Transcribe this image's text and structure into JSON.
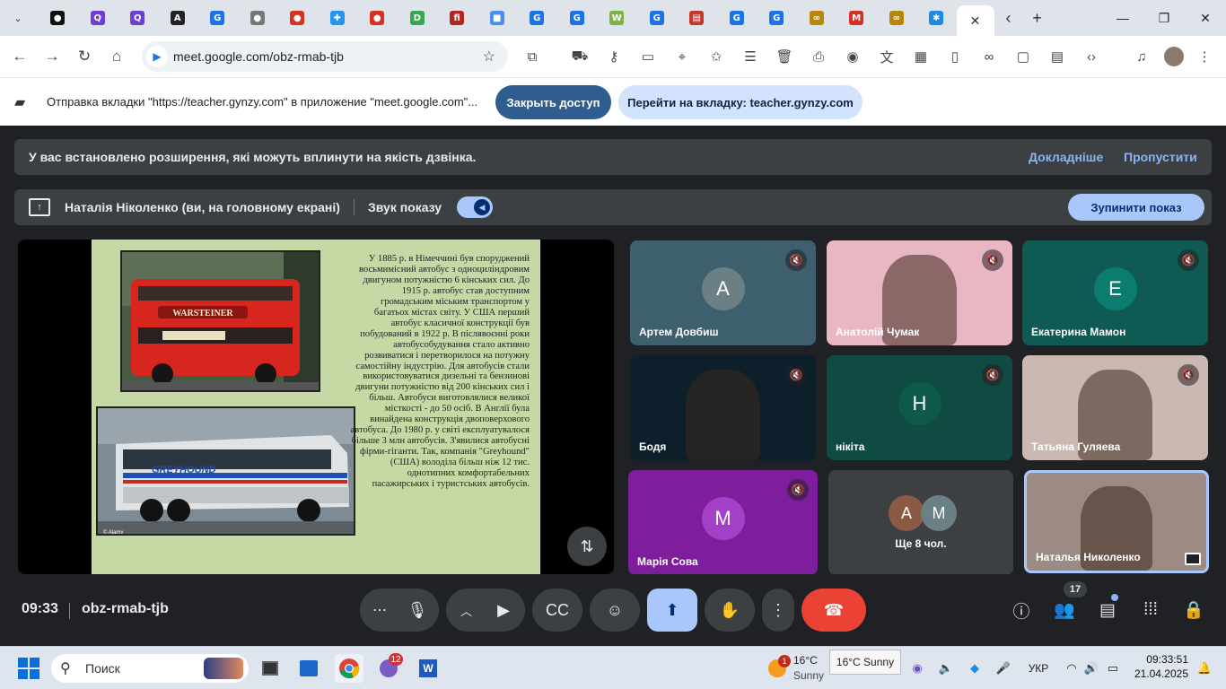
{
  "browser": {
    "tab_close": "✕",
    "url": "meet.google.com/obz-rmab-tjb",
    "tab_favicons": [
      {
        "name": "tab-chatgpt",
        "color": "#111"
      },
      {
        "name": "tab-quizlet",
        "color": "#6a3fd1"
      },
      {
        "name": "tab-quizlet-2",
        "color": "#6a3fd1"
      },
      {
        "name": "tab-app",
        "color": "#222"
      },
      {
        "name": "tab-gynzy",
        "color": "#1a73e8"
      },
      {
        "name": "tab-web",
        "color": "#777"
      },
      {
        "name": "tab-red",
        "color": "#d93025"
      },
      {
        "name": "tab-puzzle",
        "color": "#2196f3"
      },
      {
        "name": "tab-red-2",
        "color": "#d93025"
      },
      {
        "name": "tab-d",
        "color": "#34a853"
      },
      {
        "name": "tab-fi",
        "color": "#b3261e"
      },
      {
        "name": "tab-colors",
        "color": "#4a8ef0"
      },
      {
        "name": "tab-gynzy-2",
        "color": "#1a73e8"
      },
      {
        "name": "tab-gynzy-3",
        "color": "#1a73e8"
      },
      {
        "name": "tab-wordwall",
        "color": "#7cb342"
      },
      {
        "name": "tab-gynzy-4",
        "color": "#1a73e8"
      },
      {
        "name": "tab-books",
        "color": "#c0392b"
      },
      {
        "name": "tab-gynzy-5",
        "color": "#1a73e8"
      },
      {
        "name": "tab-gynzy-6",
        "color": "#1a73e8"
      },
      {
        "name": "tab-link",
        "color": "#b8860b"
      },
      {
        "name": "tab-gmail",
        "color": "#d93025"
      },
      {
        "name": "tab-link-2",
        "color": "#b8860b"
      },
      {
        "name": "tab-snow",
        "color": "#1e88e5"
      }
    ],
    "tab_letters": [
      "●",
      "Q",
      "Q",
      "A",
      "G",
      "●",
      "●",
      "✚",
      "●",
      "D",
      "fi",
      "■",
      "G",
      "G",
      "W",
      "G",
      "▤",
      "G",
      "G",
      "∞",
      "M",
      "∞",
      "✱"
    ]
  },
  "share_bar": {
    "message": "Отправка вкладки \"https://teacher.gynzy.com\" в приложение \"meet.google.com\"...",
    "stop_access": "Закрыть доступ",
    "go_to_tab": "Перейти на вкладку: teacher.gynzy.com"
  },
  "notice": {
    "message": "У вас встановлено розширення, які можуть вплинути на якість дзвінка.",
    "learn_more": "Докладніше",
    "skip": "Пропустити"
  },
  "presenting": {
    "name": "Наталія Ніколенко (ви, на головному екрані)",
    "sound_label": "Звук показу",
    "sound_on": true,
    "stop": "Зупинити показ"
  },
  "slide": {
    "text": "У 1885 р. в Німеччині був споруджений восьмимісний автобус з одноциліндровим двигуном потужністю 6 кінських сил. До 1915 р. автобус став доступним громадським міським транспортом у багатьох містах світу. У США перший автобус класичної конструкції був побудований в 1922 р. В післявоєнні роки автобусобудування стало активно розвиватися і перетворилося на потужну самостійну індустрію. Для автобусів стали використовуватися дизельні та бензинові двигуни потужністю від 200 кінських сил і більш. Автобуси виготовлялися великої місткості - до 50 осіб. В Англії була винайдена конструкція двоповерхового автобуса. До 1980 р. у світі експлуатувалося більше 3 млн автобусів. З'явилися автобусні фірми-гіганти. Так, компанія \"Greyhound\" (США) володіла більш ніж 12 тис. однотипних комфортабельних пасажирських і туристських автобусів.",
    "bus1_sign": "WARSTEINER",
    "bus2_brand": "GREYHOUND",
    "credit": "© Alamy"
  },
  "participants": [
    {
      "name": "Артем Довбиш",
      "initial": "A",
      "avatar_color": "#6b7f85",
      "bg": "#3e5f6d",
      "muted": true,
      "video": false
    },
    {
      "name": "Анатолій Чумак",
      "initial": "",
      "avatar_color": "",
      "bg": "#e9b7c4",
      "muted": true,
      "video": true
    },
    {
      "name": "Екатерина Мамон",
      "initial": "E",
      "avatar_color": "#0a7d6f",
      "bg": "#0f5a52",
      "muted": true,
      "video": false
    },
    {
      "name": "Бодя",
      "initial": "",
      "avatar_color": "",
      "bg": "#0d1f2a",
      "muted": true,
      "video": true
    },
    {
      "name": "нікіта",
      "initial": "H",
      "avatar_color": "#0e5a48",
      "bg": "#0f4b43",
      "muted": true,
      "video": false
    },
    {
      "name": "Татьяна Гуляева",
      "initial": "",
      "avatar_color": "",
      "bg": "#c9b9b2",
      "muted": true,
      "video": true
    },
    {
      "name": "Марія Сова",
      "initial": "M",
      "avatar_color": "#a340c7",
      "bg": "#7e1e9c",
      "muted": true,
      "video": false
    },
    {
      "name": "Наталья Николенко",
      "initial": "",
      "avatar_color": "",
      "bg": "#9c8a84",
      "muted": false,
      "video": true
    }
  ],
  "more_tile": {
    "label": "Ще 8 чол.",
    "initials": [
      "A",
      "M"
    ],
    "colors": [
      "#8a5a44",
      "#6b8084"
    ]
  },
  "meeting": {
    "time": "09:33",
    "code": "obz-rmab-tjb",
    "participant_count": "17"
  },
  "taskbar": {
    "search_placeholder": "Поиск",
    "teams_badge": "12",
    "weather_badge": "1",
    "temperature": "16°C",
    "condition": "Sunny",
    "tooltip": "16°C Sunny",
    "language": "УКР",
    "clock_time": "09:33:51",
    "clock_date": "21.04.2025"
  }
}
